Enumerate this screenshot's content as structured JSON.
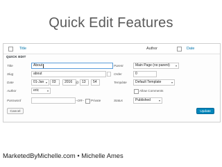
{
  "slide": {
    "title": "Quick Edit Features",
    "footer": "MarketedByMichelle.com • Michelle Ames"
  },
  "table_header": {
    "title": "Title",
    "author": "Author",
    "date": "Date"
  },
  "quick_edit": {
    "heading": "QUICK EDIT",
    "left": {
      "title_label": "Title",
      "title_value": "About",
      "slug_label": "Slug",
      "slug_value": "about",
      "date_label": "Date",
      "month": "01-Jan",
      "day": "03",
      "year": "2016",
      "at": "@",
      "hour": "13",
      "minute": "54",
      "author_label": "Author",
      "author_value": "eric",
      "password_label": "Password",
      "password_value": "",
      "or": "–OR–",
      "private_label": "Private"
    },
    "right": {
      "parent_label": "Parent",
      "parent_value": "Main Page (no parent)",
      "order_label": "Order",
      "order_value": "0",
      "template_label": "Template",
      "template_value": "Default Template",
      "allow_comments_label": "Allow Comments",
      "status_label": "Status",
      "status_value": "Published"
    },
    "cancel_label": "Cancel",
    "update_label": "Update"
  },
  "colors": {
    "link": "#0073aa",
    "update_button": "#0085ba",
    "focus_border": "#5b9dd9"
  }
}
